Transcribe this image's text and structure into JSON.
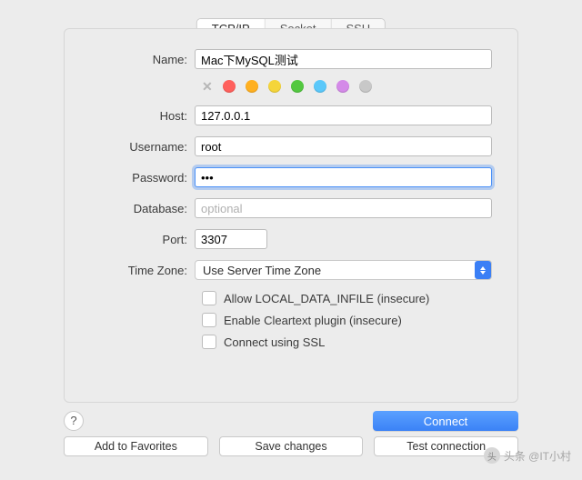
{
  "tabs": {
    "tcpip": "TCP/IP",
    "socket": "Socket",
    "ssh": "SSH"
  },
  "labels": {
    "name": "Name:",
    "host": "Host:",
    "username": "Username:",
    "password": "Password:",
    "database": "Database:",
    "port": "Port:",
    "timezone": "Time Zone:"
  },
  "values": {
    "name": "Mac下MySQL测试",
    "host": "127.0.0.1",
    "username": "root",
    "password": "•••",
    "database_placeholder": "optional",
    "port": "3307",
    "timezone": "Use Server Time Zone"
  },
  "colors": {
    "red": "#ff605c",
    "orange": "#ffb020",
    "yellow": "#f5d53a",
    "green": "#53c840",
    "blue": "#5ac8fa",
    "purple": "#d48ae8",
    "gray": "#c8c8c8"
  },
  "checks": {
    "local_infile": "Allow LOCAL_DATA_INFILE (insecure)",
    "cleartext": "Enable Cleartext plugin (insecure)",
    "ssl": "Connect using SSL"
  },
  "buttons": {
    "help": "?",
    "connect": "Connect",
    "favorites": "Add to Favorites",
    "save": "Save changes",
    "test": "Test connection"
  },
  "watermark": "头条 @IT小村"
}
